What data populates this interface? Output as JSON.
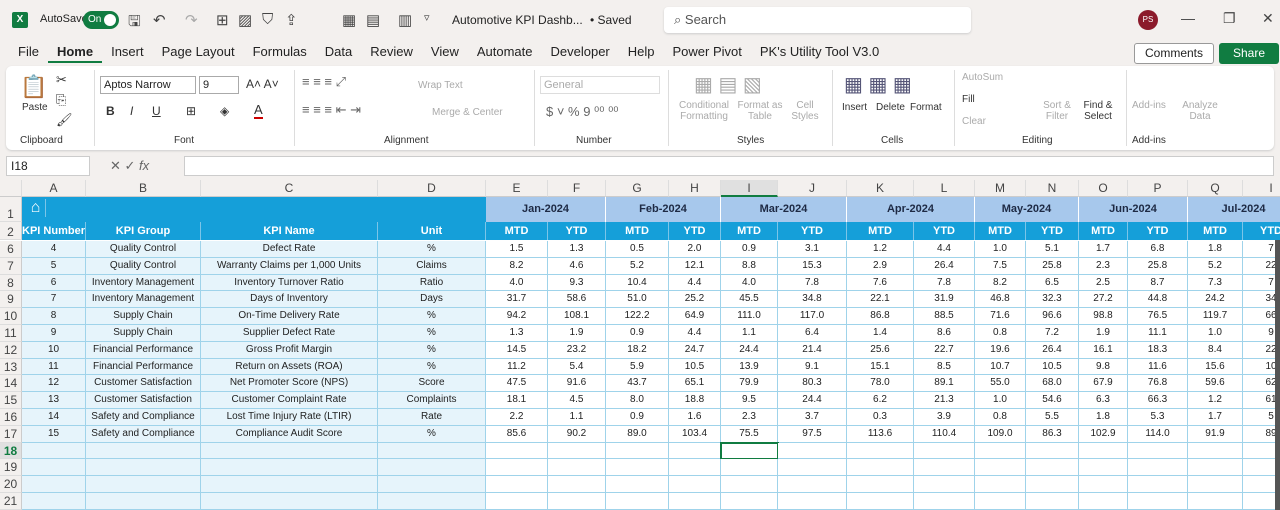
{
  "titlebar": {
    "autosave_label": "AutoSave",
    "autosave_state": "On",
    "doc_title": "Automotive KPI Dashb...",
    "saved": "• Saved",
    "search_placeholder": "Search",
    "avatar": "PS"
  },
  "tabs": [
    "File",
    "Home",
    "Insert",
    "Page Layout",
    "Formulas",
    "Data",
    "Review",
    "View",
    "Automate",
    "Developer",
    "Help",
    "Power Pivot",
    "PK's Utility Tool V3.0"
  ],
  "active_tab": "Home",
  "actions": {
    "comments": "Comments",
    "share": "Share"
  },
  "ribbon": {
    "clipboard": {
      "label": "Clipboard",
      "paste": "Paste"
    },
    "font": {
      "label": "Font",
      "name": "Aptos Narrow",
      "size": "9"
    },
    "alignment": {
      "label": "Alignment",
      "wrap": "Wrap Text",
      "merge": "Merge & Center"
    },
    "number": {
      "label": "Number",
      "format": "General"
    },
    "styles": {
      "label": "Styles",
      "conditional": "Conditional Formatting",
      "format_table": "Format as Table",
      "cell_styles": "Cell Styles"
    },
    "cells": {
      "label": "Cells",
      "insert": "Insert",
      "delete": "Delete",
      "format": "Format"
    },
    "editing": {
      "label": "Editing",
      "autosum": "AutoSum",
      "fill": "Fill",
      "clear": "Clear",
      "sort": "Sort & Filter",
      "find": "Find & Select"
    },
    "addins": {
      "label": "Add-ins",
      "addins": "Add-ins",
      "analyze": "Analyze Data"
    }
  },
  "formula_bar": {
    "name_box": "I18",
    "fx": "fx",
    "value": ""
  },
  "columns": [
    "A",
    "B",
    "C",
    "D",
    "E",
    "F",
    "G",
    "H",
    "I",
    "J",
    "K",
    "L",
    "M",
    "N",
    "O",
    "P",
    "Q",
    "I"
  ],
  "selected_column": "I",
  "selected_cell": "I18",
  "table": {
    "headers": [
      "KPI Number",
      "KPI Group",
      "KPI Name",
      "Unit"
    ],
    "months": [
      "Jan-2024",
      "Feb-2024",
      "Mar-2024",
      "Apr-2024",
      "May-2024",
      "Jun-2024",
      "Jul-2024"
    ],
    "sub_headers": [
      "MTD",
      "YTD"
    ],
    "rows": [
      {
        "row": "6",
        "num": "4",
        "group": "Quality Control",
        "name": "Defect Rate",
        "unit": "%",
        "values": [
          "1.5",
          "1.3",
          "0.5",
          "2.0",
          "0.9",
          "3.1",
          "1.2",
          "4.4",
          "1.0",
          "5.1",
          "1.7",
          "6.8",
          "1.8",
          "7"
        ]
      },
      {
        "row": "7",
        "num": "5",
        "group": "Quality Control",
        "name": "Warranty Claims per 1,000 Units",
        "unit": "Claims",
        "values": [
          "8.2",
          "4.6",
          "5.2",
          "12.1",
          "8.8",
          "15.3",
          "2.9",
          "26.4",
          "7.5",
          "25.8",
          "2.3",
          "25.8",
          "5.2",
          "22"
        ]
      },
      {
        "row": "8",
        "num": "6",
        "group": "Inventory Management",
        "name": "Inventory Turnover Ratio",
        "unit": "Ratio",
        "values": [
          "4.0",
          "9.3",
          "10.4",
          "4.4",
          "4.0",
          "7.8",
          "7.6",
          "7.8",
          "8.2",
          "6.5",
          "2.5",
          "8.7",
          "7.3",
          "7"
        ]
      },
      {
        "row": "9",
        "num": "7",
        "group": "Inventory Management",
        "name": "Days of Inventory",
        "unit": "Days",
        "values": [
          "31.7",
          "58.6",
          "51.0",
          "25.2",
          "45.5",
          "34.8",
          "22.1",
          "31.9",
          "46.8",
          "32.3",
          "27.2",
          "44.8",
          "24.2",
          "34"
        ]
      },
      {
        "row": "10",
        "num": "8",
        "group": "Supply Chain",
        "name": "On-Time Delivery Rate",
        "unit": "%",
        "values": [
          "94.2",
          "108.1",
          "122.2",
          "64.9",
          "111.0",
          "117.0",
          "86.8",
          "88.5",
          "71.6",
          "96.6",
          "98.8",
          "76.5",
          "119.7",
          "66"
        ]
      },
      {
        "row": "11",
        "num": "9",
        "group": "Supply Chain",
        "name": "Supplier Defect Rate",
        "unit": "%",
        "values": [
          "1.3",
          "1.9",
          "0.9",
          "4.4",
          "1.1",
          "6.4",
          "1.4",
          "8.6",
          "0.8",
          "7.2",
          "1.9",
          "11.1",
          "1.0",
          "9"
        ]
      },
      {
        "row": "12",
        "num": "10",
        "group": "Financial Performance",
        "name": "Gross Profit Margin",
        "unit": "%",
        "values": [
          "14.5",
          "23.2",
          "18.2",
          "24.7",
          "24.4",
          "21.4",
          "25.6",
          "22.7",
          "19.6",
          "26.4",
          "16.1",
          "18.3",
          "8.4",
          "22"
        ]
      },
      {
        "row": "13",
        "num": "11",
        "group": "Financial Performance",
        "name": "Return on Assets (ROA)",
        "unit": "%",
        "values": [
          "11.2",
          "5.4",
          "5.9",
          "10.5",
          "13.9",
          "9.1",
          "15.1",
          "8.5",
          "10.7",
          "10.5",
          "9.8",
          "11.6",
          "15.6",
          "10"
        ]
      },
      {
        "row": "14",
        "num": "12",
        "group": "Customer Satisfaction",
        "name": "Net Promoter Score (NPS)",
        "unit": "Score",
        "values": [
          "47.5",
          "91.6",
          "43.7",
          "65.1",
          "79.9",
          "80.3",
          "78.0",
          "89.1",
          "55.0",
          "68.0",
          "67.9",
          "76.8",
          "59.6",
          "62"
        ]
      },
      {
        "row": "15",
        "num": "13",
        "group": "Customer Satisfaction",
        "name": "Customer Complaint Rate",
        "unit": "Complaints",
        "values": [
          "18.1",
          "4.5",
          "8.0",
          "18.8",
          "9.5",
          "24.4",
          "6.2",
          "21.3",
          "1.0",
          "54.6",
          "6.3",
          "66.3",
          "1.2",
          "61"
        ]
      },
      {
        "row": "16",
        "num": "14",
        "group": "Safety and Compliance",
        "name": "Lost Time Injury Rate (LTIR)",
        "unit": "Rate",
        "values": [
          "2.2",
          "1.1",
          "0.9",
          "1.6",
          "2.3",
          "3.7",
          "0.3",
          "3.9",
          "0.8",
          "5.5",
          "1.8",
          "5.3",
          "1.7",
          "5"
        ]
      },
      {
        "row": "17",
        "num": "15",
        "group": "Safety and Compliance",
        "name": "Compliance Audit Score",
        "unit": "%",
        "values": [
          "85.6",
          "90.2",
          "89.0",
          "103.4",
          "75.5",
          "97.5",
          "113.6",
          "110.4",
          "109.0",
          "86.3",
          "102.9",
          "114.0",
          "91.9",
          "89"
        ]
      }
    ],
    "empty_rows": [
      "18",
      "19",
      "20",
      "21"
    ]
  },
  "colors": {
    "header_blue": "#159fd9",
    "month_blue": "#a7c8ec",
    "excel_green": "#107c41",
    "grid_line": "#9fd3ea"
  }
}
